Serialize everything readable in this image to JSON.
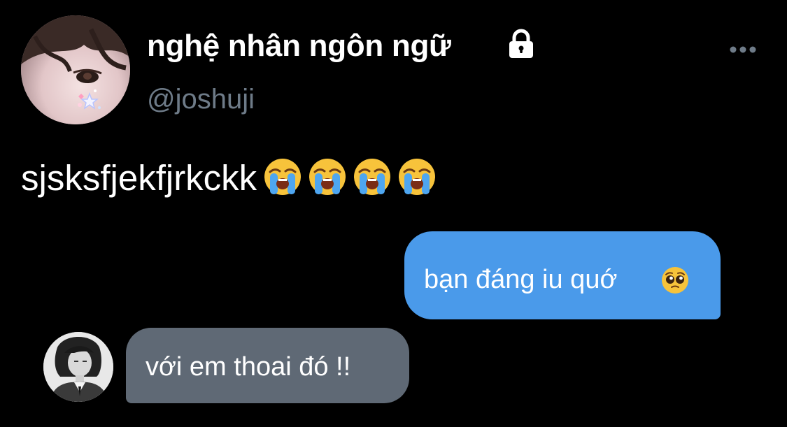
{
  "profile": {
    "display_name": "nghệ nhân ngôn ngữ",
    "handle": "@joshuji",
    "avatar_icon": "profile-photo",
    "lock_icon": "lock-icon",
    "more_icon": "more-horizontal-icon"
  },
  "tweet": {
    "text": "sjsksfjekfjrkckk",
    "emojis": [
      "loudly-crying-face",
      "loudly-crying-face",
      "loudly-crying-face",
      "loudly-crying-face"
    ]
  },
  "messages": {
    "outgoing": {
      "text": "bạn đáng iu quớ",
      "emoji": "pleading-face",
      "bubble_color": "#4a9aea"
    },
    "incoming": {
      "text": "với em thoai đó !!",
      "bubble_color": "#5f6975"
    }
  },
  "colors": {
    "background": "#000000",
    "handle": "#6e7b88",
    "text": "#ffffff"
  }
}
